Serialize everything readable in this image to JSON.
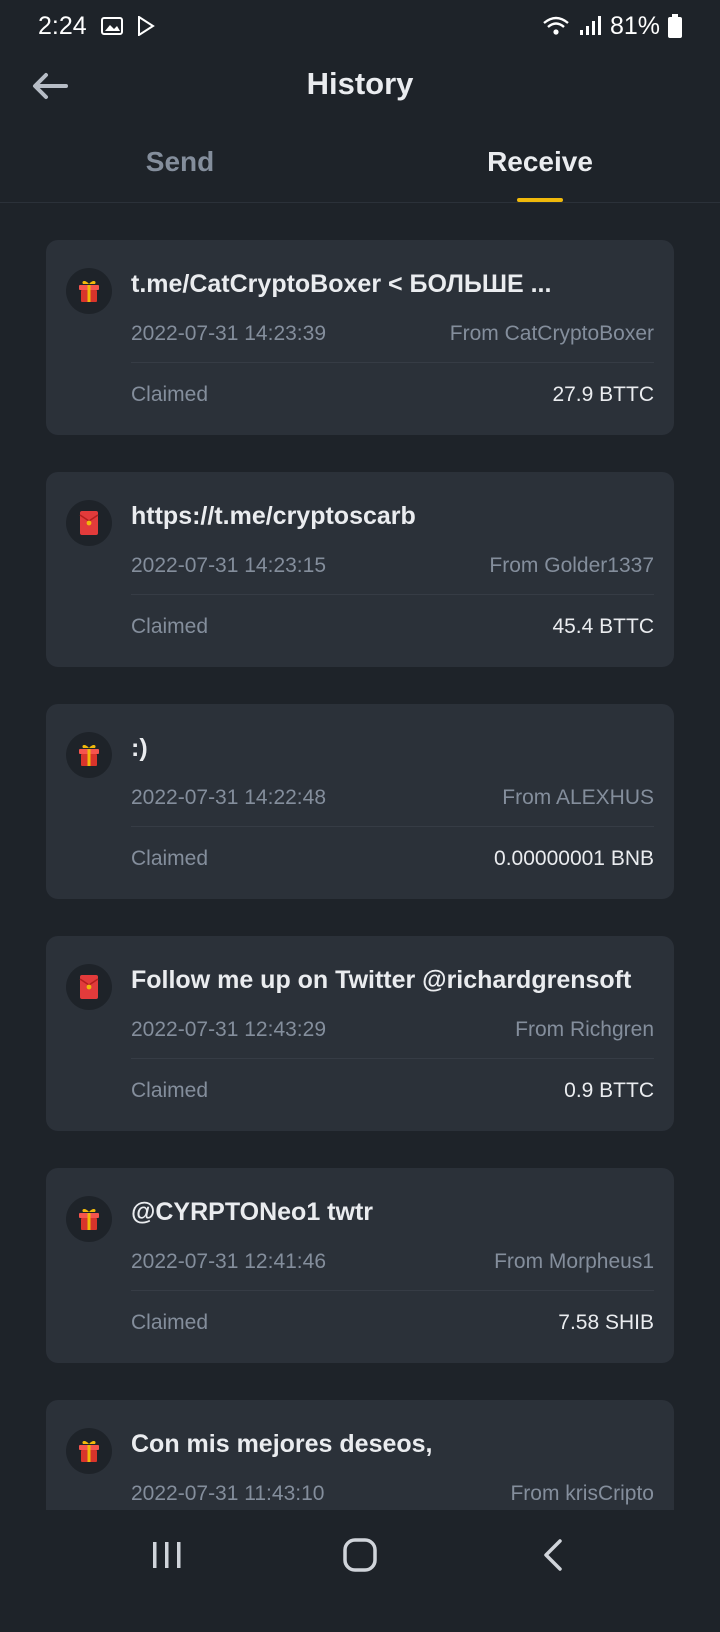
{
  "status_bar": {
    "time": "2:24",
    "battery": "81%",
    "icons": [
      "gallery-icon",
      "play-store-icon",
      "wifi-icon",
      "signal-icon",
      "battery-icon"
    ]
  },
  "header": {
    "title": "History",
    "back_icon": "arrow-left-icon"
  },
  "tabs": [
    {
      "label": "Send",
      "active": false
    },
    {
      "label": "Receive",
      "active": true
    }
  ],
  "colors": {
    "background": "#1e2329",
    "card": "#2b3139",
    "accent": "#f0b90b",
    "muted_text": "#848e9c",
    "primary_text": "#eaecef",
    "gift_red": "#d9342b"
  },
  "records": [
    {
      "icon": "gift-box-icon",
      "title": "t.me/CatCryptoBoxer < БОЛЬШЕ ...",
      "date": "2022-07-31 14:23:39",
      "from": "From CatCryptoBoxer",
      "status": "Claimed",
      "amount": "27.9 BTTC"
    },
    {
      "icon": "red-envelope-icon",
      "title": "https://t.me/cryptoscarb",
      "date": "2022-07-31 14:23:15",
      "from": "From Golder1337",
      "status": "Claimed",
      "amount": "45.4 BTTC"
    },
    {
      "icon": "gift-box-icon",
      "title": ":)",
      "date": "2022-07-31 14:22:48",
      "from": "From ALEXHUS",
      "status": "Claimed",
      "amount": "0.00000001 BNB"
    },
    {
      "icon": "red-envelope-icon",
      "title": "Follow me up on Twitter @richardgrensoft",
      "date": "2022-07-31 12:43:29",
      "from": "From Richgren",
      "status": "Claimed",
      "amount": "0.9 BTTC"
    },
    {
      "icon": "gift-box-icon",
      "title": "@CYRPTONeo1 twtr",
      "date": "2022-07-31 12:41:46",
      "from": "From Morpheus1",
      "status": "Claimed",
      "amount": "7.58 SHIB"
    },
    {
      "icon": "gift-box-icon",
      "title": "Con mis mejores deseos,",
      "date": "2022-07-31 11:43:10",
      "from": "From krisCripto",
      "status": "",
      "amount": ""
    }
  ],
  "nav_bar": {
    "buttons": [
      "recent-apps-icon",
      "home-icon",
      "back-icon"
    ]
  }
}
